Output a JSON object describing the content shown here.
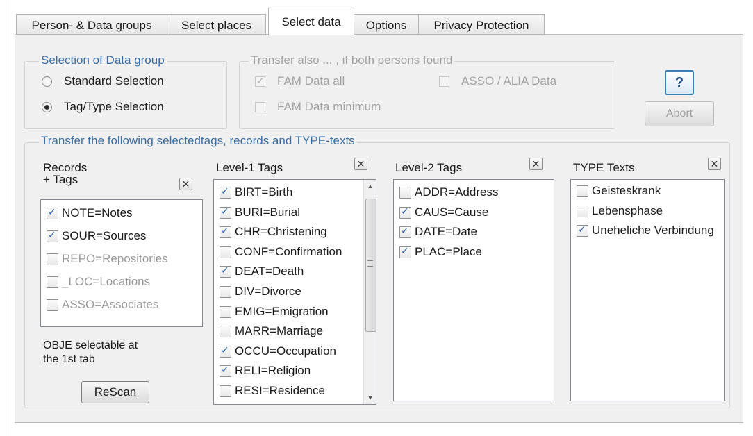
{
  "tabs": [
    "Person- & Data groups",
    "Select places",
    "Select data",
    "Options",
    "Privacy Protection"
  ],
  "selection_group": {
    "title": "Selection of Data group",
    "options": [
      {
        "label": "Standard Selection",
        "selected": false
      },
      {
        "label": "Tag/Type Selection",
        "selected": true
      }
    ]
  },
  "transfer_group": {
    "title": "Transfer also ... , if both persons found",
    "fam_all": {
      "label": "FAM Data all",
      "checked": true
    },
    "fam_min": {
      "label": "FAM Data minimum",
      "checked": false
    },
    "asso_alia": {
      "label": "ASSO / ALIA Data",
      "checked": false
    }
  },
  "help_button": "?",
  "abort_button": "Abort",
  "tags_group": {
    "title": "Transfer the following selectedtags, records and TYPE-texts",
    "records": {
      "title_line1": "Records",
      "title_line2": "+ Tags",
      "items": [
        {
          "label": "NOTE=Notes",
          "checked": true
        },
        {
          "label": "SOUR=Sources",
          "checked": true
        },
        {
          "label": "REPO=Repositories",
          "checked": false
        },
        {
          "label": "_LOC=Locations",
          "checked": false
        },
        {
          "label": "ASSO=Associates",
          "checked": false
        }
      ],
      "note_line1": "OBJE selectable at",
      "note_line2": "the 1st tab",
      "rescan_button": "ReScan"
    },
    "level1": {
      "title": "Level-1 Tags",
      "items": [
        {
          "label": "BIRT=Birth",
          "checked": true
        },
        {
          "label": "BURI=Burial",
          "checked": true
        },
        {
          "label": "CHR=Christening",
          "checked": true
        },
        {
          "label": "CONF=Confirmation",
          "checked": false
        },
        {
          "label": "DEAT=Death",
          "checked": true
        },
        {
          "label": "DIV=Divorce",
          "checked": false
        },
        {
          "label": "EMIG=Emigration",
          "checked": false
        },
        {
          "label": "MARR=Marriage",
          "checked": false
        },
        {
          "label": "OCCU=Occupation",
          "checked": true
        },
        {
          "label": "RELI=Religion",
          "checked": true
        },
        {
          "label": "RESI=Residence",
          "checked": false
        }
      ]
    },
    "level2": {
      "title": "Level-2 Tags",
      "items": [
        {
          "label": "ADDR=Address",
          "checked": false
        },
        {
          "label": "CAUS=Cause",
          "checked": true
        },
        {
          "label": "DATE=Date",
          "checked": true
        },
        {
          "label": "PLAC=Place",
          "checked": true
        }
      ]
    },
    "type_texts": {
      "title": "TYPE Texts",
      "items": [
        {
          "label": "Geisteskrank",
          "checked": false
        },
        {
          "label": "Lebensphase",
          "checked": false
        },
        {
          "label": "Uneheliche Verbindung",
          "checked": true
        }
      ]
    }
  }
}
